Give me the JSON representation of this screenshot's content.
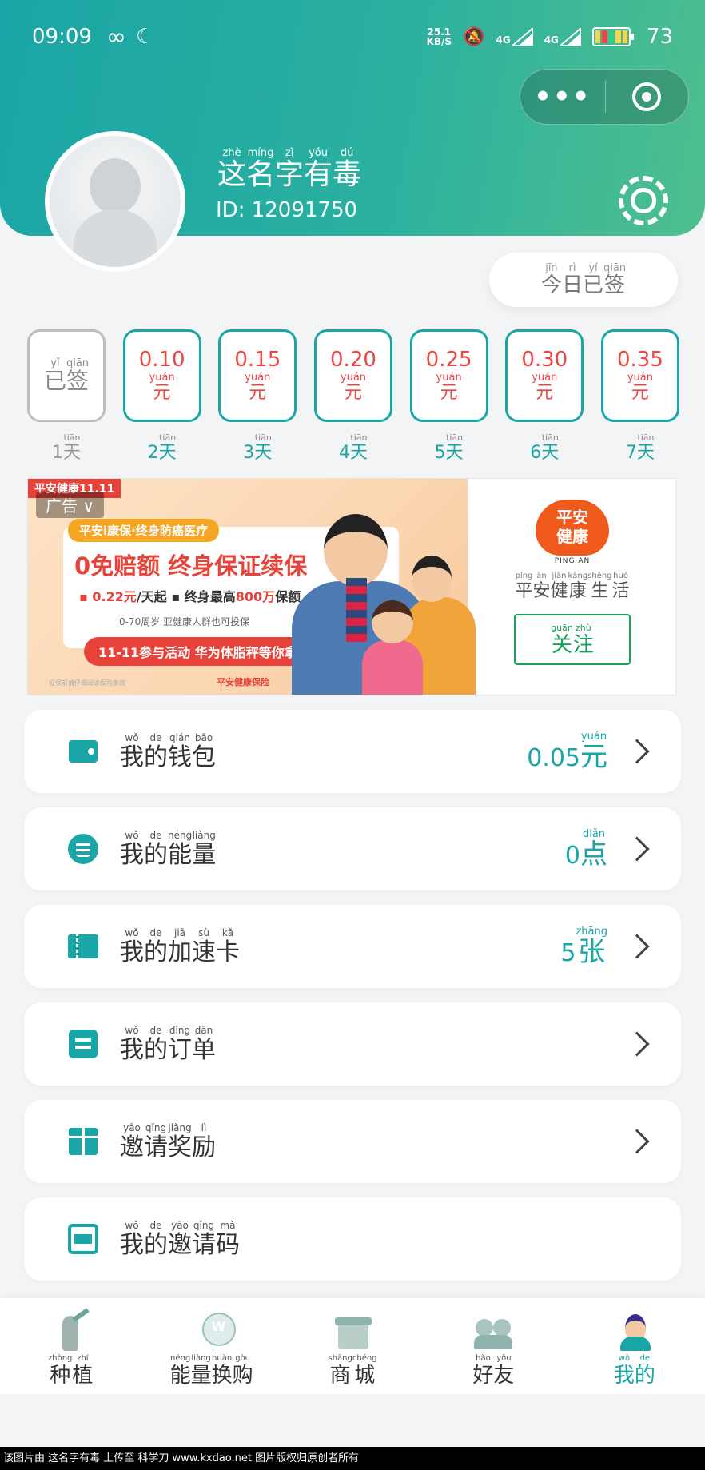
{
  "status_bar": {
    "time": "09:09",
    "infinity": "∞",
    "moon": "☾",
    "speed_value": "25.1",
    "speed_unit": "KB/S",
    "net1": "4G",
    "net2": "4G",
    "battery": "73"
  },
  "capsule": {
    "more": "•••"
  },
  "profile": {
    "name": [
      {
        "py": "zhè",
        "hz": "这"
      },
      {
        "py": "míng",
        "hz": "名"
      },
      {
        "py": "zì",
        "hz": "字"
      },
      {
        "py": "yǒu",
        "hz": "有"
      },
      {
        "py": "dú",
        "hz": "毒"
      }
    ],
    "id_text": "ID: 12091750"
  },
  "signed_button": [
    {
      "py": "jīn",
      "hz": "今"
    },
    {
      "py": "rì",
      "hz": "日"
    },
    {
      "py": "yǐ",
      "hz": "已"
    },
    {
      "py": "qiān",
      "hz": "签"
    }
  ],
  "checkin": {
    "done_text": [
      {
        "py": "yǐ",
        "hz": "已"
      },
      {
        "py": "qiān",
        "hz": "签"
      }
    ],
    "unit_py": "yuán",
    "unit_hz": "元",
    "day_py": "tiān",
    "day_hz": "天",
    "days": [
      {
        "num": "1",
        "amount": "",
        "done": true
      },
      {
        "num": "2",
        "amount": "0.10",
        "done": false
      },
      {
        "num": "3",
        "amount": "0.15",
        "done": false
      },
      {
        "num": "4",
        "amount": "0.20",
        "done": false
      },
      {
        "num": "5",
        "amount": "0.25",
        "done": false
      },
      {
        "num": "6",
        "amount": "0.30",
        "done": false
      },
      {
        "num": "7",
        "amount": "0.35",
        "done": false
      }
    ]
  },
  "ad": {
    "tag": "平安健康11.11",
    "label": "广告 ∨",
    "pill": "平安i康保·终身防癌医疗",
    "headline": "0免赔额 终身保证续保",
    "line1_a": "▪ 0.22元",
    "line1_b": "/天起  ▪ 终身最高",
    "line1_c": "800万",
    "line1_d": "保额",
    "line2": "0-70周岁 亚健康人群也可投保",
    "cta": "11-11参与活动 华为体脂秤等你拿",
    "footer": "平安健康保险",
    "fine": "投保前请仔细阅读保险条款",
    "brand_logo": "平安\n健康",
    "brand_en": "PING AN",
    "brand_name": [
      {
        "py": "píng",
        "hz": "平"
      },
      {
        "py": "ān",
        "hz": "安"
      },
      {
        "py": "jiàn",
        "hz": "健"
      },
      {
        "py": "kāng",
        "hz": "康"
      },
      {
        "py": "shēng",
        "hz": "生"
      },
      {
        "py": "huó",
        "hz": "活"
      }
    ],
    "follow": [
      {
        "py": "guān",
        "hz": "关"
      },
      {
        "py": "zhù",
        "hz": "注"
      }
    ]
  },
  "menu": [
    {
      "name": "wallet",
      "icon": "wallet-icon",
      "title": [
        {
          "py": "wǒ",
          "hz": "我"
        },
        {
          "py": "de",
          "hz": "的"
        },
        {
          "py": "qián",
          "hz": "钱"
        },
        {
          "py": "bāo",
          "hz": "包"
        }
      ],
      "value": "0.05",
      "unit_py": "yuán",
      "unit_hz": "元",
      "chevron": true
    },
    {
      "name": "energy",
      "icon": "energy-icon",
      "title": [
        {
          "py": "wǒ",
          "hz": "我"
        },
        {
          "py": "de",
          "hz": "的"
        },
        {
          "py": "néng",
          "hz": "能"
        },
        {
          "py": "liàng",
          "hz": "量"
        }
      ],
      "value": "0",
      "unit_py": "diǎn",
      "unit_hz": "点",
      "chevron": true
    },
    {
      "name": "speed-card",
      "icon": "ticket-icon",
      "title": [
        {
          "py": "wǒ",
          "hz": "我"
        },
        {
          "py": "de",
          "hz": "的"
        },
        {
          "py": "jiā",
          "hz": "加"
        },
        {
          "py": "sù",
          "hz": "速"
        },
        {
          "py": "kǎ",
          "hz": "卡"
        }
      ],
      "value": "5",
      "unit_py": "zhāng",
      "unit_hz": "张",
      "chevron": true
    },
    {
      "name": "orders",
      "icon": "order-icon",
      "title": [
        {
          "py": "wǒ",
          "hz": "我"
        },
        {
          "py": "de",
          "hz": "的"
        },
        {
          "py": "dìng",
          "hz": "订"
        },
        {
          "py": "dān",
          "hz": "单"
        }
      ],
      "value": "",
      "unit_py": "",
      "unit_hz": "",
      "chevron": true
    },
    {
      "name": "invite-rewards",
      "icon": "gift-icon",
      "title": [
        {
          "py": "yāo",
          "hz": "邀"
        },
        {
          "py": "qǐng",
          "hz": "请"
        },
        {
          "py": "jiǎng",
          "hz": "奖"
        },
        {
          "py": "lì",
          "hz": "励"
        }
      ],
      "value": "",
      "unit_py": "",
      "unit_hz": "",
      "chevron": true
    },
    {
      "name": "invite-code",
      "icon": "scan-icon",
      "title": [
        {
          "py": "wǒ",
          "hz": "我"
        },
        {
          "py": "de",
          "hz": "的"
        },
        {
          "py": "yāo",
          "hz": "邀"
        },
        {
          "py": "qǐng",
          "hz": "请"
        },
        {
          "py": "mǎ",
          "hz": "码"
        }
      ],
      "value": "",
      "unit_py": "",
      "unit_hz": "",
      "chevron": false
    }
  ],
  "tabs": [
    {
      "name": "plant",
      "icon": "plant-icon",
      "cls": "t-plant",
      "active": false,
      "label": [
        {
          "py": "zhòng",
          "hz": "种"
        },
        {
          "py": "zhí",
          "hz": "植"
        }
      ]
    },
    {
      "name": "energy-exchange",
      "icon": "energy-exchange-icon",
      "cls": "t-energy",
      "active": false,
      "label": [
        {
          "py": "néng",
          "hz": "能"
        },
        {
          "py": "liàng",
          "hz": "量"
        },
        {
          "py": "huàn",
          "hz": "换"
        },
        {
          "py": "gòu",
          "hz": "购"
        }
      ]
    },
    {
      "name": "mall",
      "icon": "gift-box-icon",
      "cls": "t-shop",
      "active": false,
      "label": [
        {
          "py": "shāng",
          "hz": "商"
        },
        {
          "py": "chéng",
          "hz": "城"
        }
      ]
    },
    {
      "name": "friends",
      "icon": "friends-icon",
      "cls": "t-friends",
      "active": false,
      "label": [
        {
          "py": "hǎo",
          "hz": "好"
        },
        {
          "py": "yǒu",
          "hz": "友"
        }
      ]
    },
    {
      "name": "mine",
      "icon": "user-icon",
      "cls": "t-me",
      "active": true,
      "label": [
        {
          "py": "wǒ",
          "hz": "我"
        },
        {
          "py": "de",
          "hz": "的"
        }
      ]
    }
  ],
  "watermark": "该图片由 这名字有毒 上传至 科学刀 www.kxdao.net 图片版权归原创者所有",
  "colors": {
    "accent": "#1aa5a6",
    "price_red": "#e44444",
    "follow_green": "#19a35a"
  }
}
